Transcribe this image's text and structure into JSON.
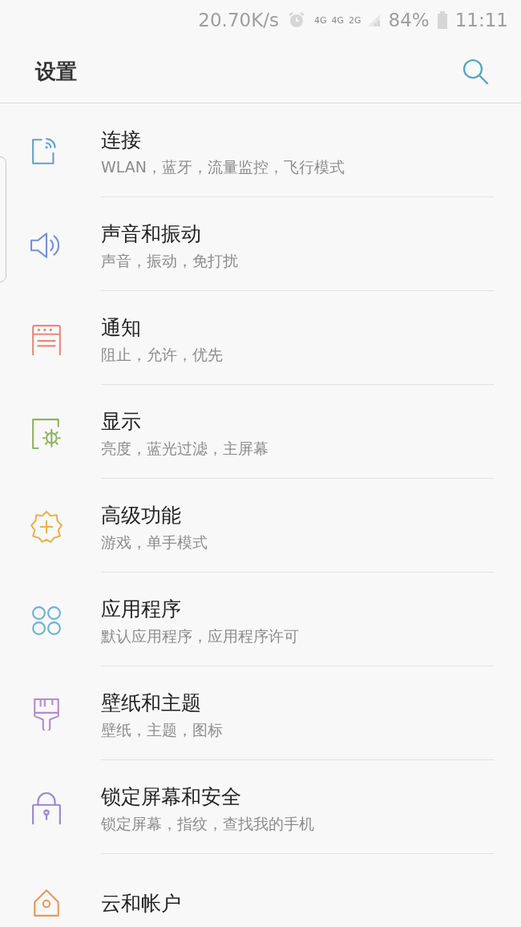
{
  "status_bar": {
    "speed": "20.70K/s",
    "network_labels": [
      "4G",
      "4G",
      "2G"
    ],
    "battery": "84%",
    "time": "11:11"
  },
  "header": {
    "title": "设置"
  },
  "items": [
    {
      "kind": "connections",
      "title": "连接",
      "subtitle": "WLAN，蓝牙，流量监控，飞行模式"
    },
    {
      "kind": "sound",
      "title": "声音和振动",
      "subtitle": "声音，振动，免打扰"
    },
    {
      "kind": "notifications",
      "title": "通知",
      "subtitle": "阻止，允许，优先"
    },
    {
      "kind": "display",
      "title": "显示",
      "subtitle": "亮度，蓝光过滤，主屏幕"
    },
    {
      "kind": "advanced",
      "title": "高级功能",
      "subtitle": "游戏，单手模式"
    },
    {
      "kind": "apps",
      "title": "应用程序",
      "subtitle": "默认应用程序，应用程序许可"
    },
    {
      "kind": "wallpaper",
      "title": "壁纸和主题",
      "subtitle": "壁纸，主题，图标"
    },
    {
      "kind": "lock",
      "title": "锁定屏幕和安全",
      "subtitle": "锁定屏幕，指纹，查找我的手机"
    },
    {
      "kind": "cloud",
      "title": "云和帐户"
    }
  ]
}
